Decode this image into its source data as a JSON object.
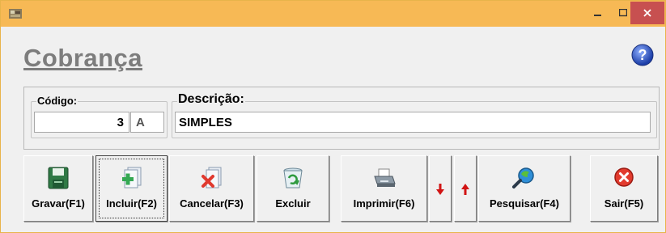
{
  "window": {
    "title": ""
  },
  "page": {
    "title": "Cobrança"
  },
  "fields": {
    "codigo": {
      "label": "Código:",
      "value": "3",
      "suffix": "A"
    },
    "descricao": {
      "label": "Descrição:",
      "value": "SIMPLES"
    }
  },
  "toolbar": {
    "gravar": "Gravar(F1)",
    "incluir": "Incluir(F2)",
    "cancelar": "Cancelar(F3)",
    "excluir": "Excluir",
    "imprimir": "Imprimir(F6)",
    "pesquisar": "Pesquisar(F4)",
    "sair": "Sair(F5)"
  },
  "icons": {
    "gravar": "floppy-disk-icon",
    "incluir": "new-document-icon",
    "cancelar": "cancel-document-icon",
    "excluir": "recycle-bin-icon",
    "imprimir": "printer-icon",
    "next": "arrow-down-icon",
    "previous": "arrow-up-icon",
    "pesquisar": "magnifier-icon",
    "sair": "exit-icon",
    "help": "help-icon"
  },
  "colors": {
    "titlebar": "#f7b955",
    "close_button": "#c75050",
    "title_text": "#7d7d7d"
  }
}
